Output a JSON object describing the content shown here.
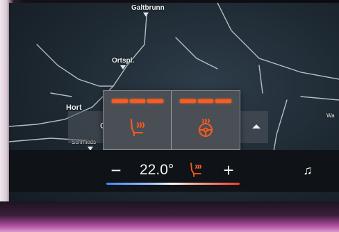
{
  "map": {
    "places": [
      {
        "id": "galtbrunn",
        "label": "Galtbrunn"
      },
      {
        "id": "ortspl",
        "label": "Ortspl."
      },
      {
        "id": "hort",
        "label": "Hort"
      },
      {
        "id": "schmieds",
        "label": "Schmieds"
      },
      {
        "id": "right",
        "label": "Wa"
      },
      {
        "id": "c",
        "label": "C"
      }
    ]
  },
  "seat_popup": {
    "driver_seat": {
      "icon": "seat-heating-icon",
      "level": 3,
      "max_level": 3
    },
    "steering_wheel": {
      "icon": "steering-wheel-heating-icon",
      "level": 3,
      "max_level": 3
    }
  },
  "climate": {
    "minus_label": "−",
    "temperature": "22.0°",
    "plus_label": "+",
    "seat_heat_icon": "seat-heating-icon",
    "music_icon": "music-note-icon",
    "music_label": "♫"
  },
  "colors": {
    "heat_active": "#ff5a1e",
    "cold": "#3a8bff",
    "hot": "#ff3b2a"
  }
}
